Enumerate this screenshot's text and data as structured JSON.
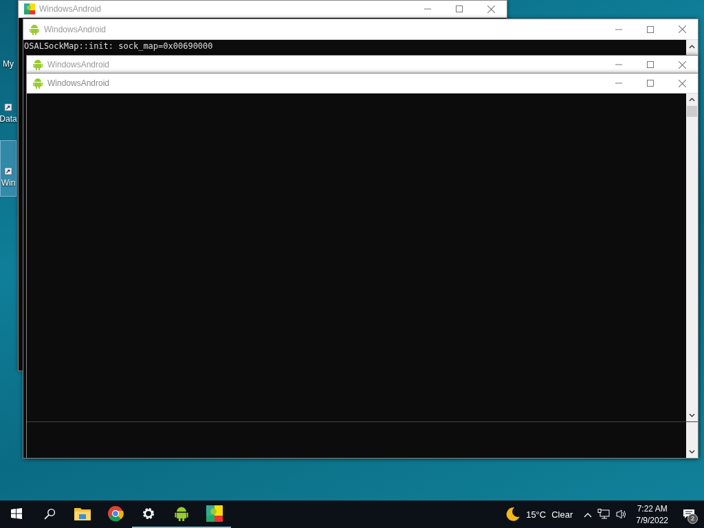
{
  "desktop_icons": [
    {
      "label": "My",
      "selected": false
    },
    {
      "label": "Data",
      "selected": false
    },
    {
      "label": "Win",
      "selected": true
    }
  ],
  "windows": [
    {
      "title": "WindowsAndroid",
      "kind": "app",
      "active": false
    },
    {
      "title": "WindowsAndroid",
      "kind": "android",
      "active": false,
      "console_lines": [
        "OSALSockMap::init: sock_map=0x00690000"
      ]
    },
    {
      "title": "WindowsAndroid",
      "kind": "android",
      "active": false
    },
    {
      "title": "WindowsAndroid",
      "kind": "android",
      "active": true
    }
  ],
  "taskbar": {
    "apps": [
      {
        "kind": "folder",
        "running": false
      },
      {
        "kind": "browser",
        "running": false
      },
      {
        "kind": "gear",
        "running": true
      },
      {
        "kind": "android",
        "running": true
      },
      {
        "kind": "app",
        "running": true
      }
    ],
    "weather": {
      "temperature": "15°C",
      "condition": "Clear"
    },
    "clock": {
      "time": "7:22 AM",
      "date": "7/9/2022"
    },
    "notifications": {
      "count": "2"
    }
  }
}
